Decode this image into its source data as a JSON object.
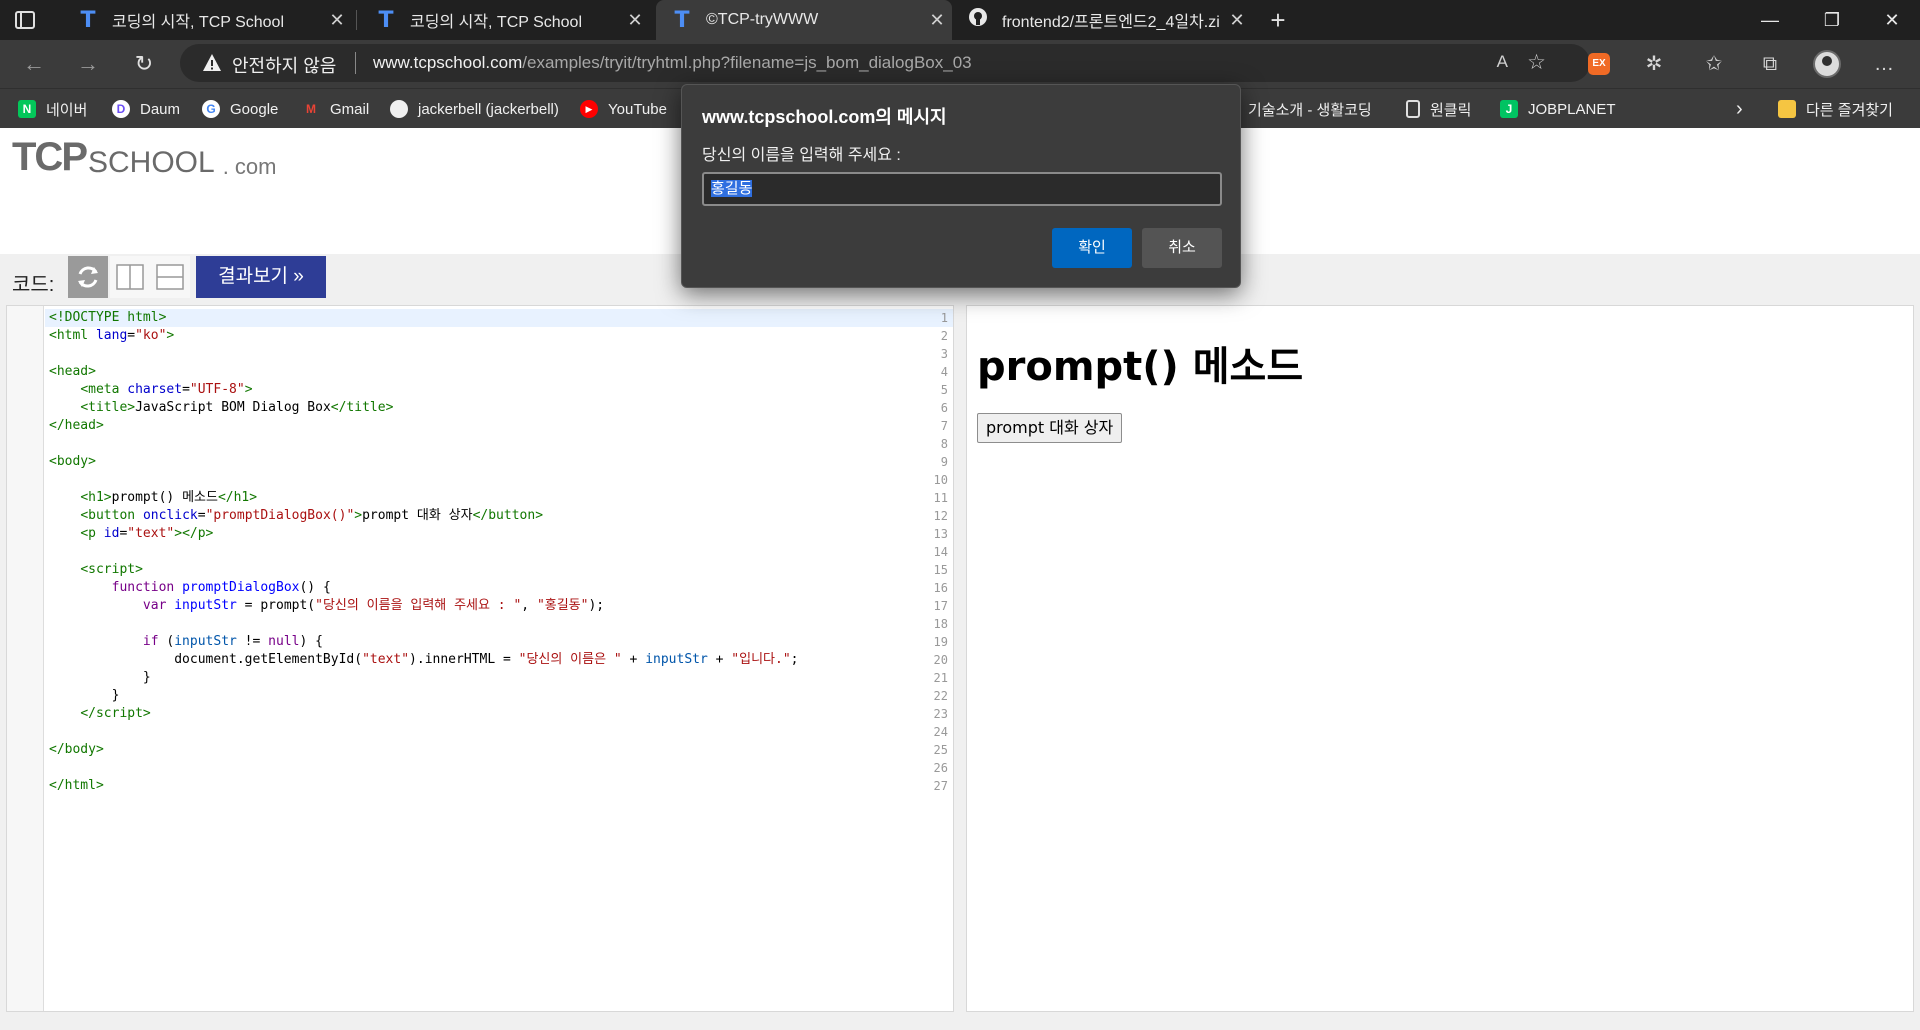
{
  "browser": {
    "tabs": [
      {
        "title": "코딩의 시작, TCP School",
        "favicon": "tcp-t-icon",
        "active": false
      },
      {
        "title": "코딩의 시작, TCP School",
        "favicon": "tcp-t-icon",
        "active": false
      },
      {
        "title": "©TCP-tryWWW",
        "favicon": "tcp-t-icon",
        "active": true
      },
      {
        "title": "frontend2/프론트엔드2_4일차.zi",
        "favicon": "github-icon",
        "active": false
      }
    ],
    "address": {
      "security_label": "안전하지 않음",
      "url_domain": "www.tcpschool.com",
      "url_path": "/examples/tryit/tryhtml.php?filename=js_bom_dialogBox_03",
      "read_aloud": "A",
      "ext_label": "EX"
    },
    "bookmarks": [
      {
        "label": "네이버",
        "icon": "naver-icon"
      },
      {
        "label": "Daum",
        "icon": "daum-icon"
      },
      {
        "label": "Google",
        "icon": "google-icon"
      },
      {
        "label": "Gmail",
        "icon": "gmail-icon"
      },
      {
        "label": "jackerbell (jackerbell)",
        "icon": "github-icon"
      },
      {
        "label": "YouTube",
        "icon": "youtube-icon"
      },
      {
        "label": "기술소개 - 생활코딩",
        "icon": "page-icon"
      },
      {
        "label": "원클릭",
        "icon": "page-icon"
      },
      {
        "label": "JOBPLANET",
        "icon": "jobplanet-icon"
      },
      {
        "label": "다른 즐겨찾기",
        "icon": "folder-icon"
      }
    ]
  },
  "site": {
    "logo_tcp": "TCP",
    "logo_school": "SCHOOL",
    "logo_dotcom": ". com",
    "code_label": "코드:",
    "result_button": "결과보기 »"
  },
  "editor": {
    "line_numbers": [
      "1",
      "2",
      "3",
      "4",
      "5",
      "6",
      "7",
      "8",
      "9",
      "10",
      "11",
      "12",
      "13",
      "14",
      "15",
      "16",
      "17",
      "18",
      "19",
      "20",
      "21",
      "22",
      "23",
      "24",
      "25",
      "26",
      "27"
    ]
  },
  "preview": {
    "heading": "prompt() 메소드",
    "button": "prompt 대화 상자"
  },
  "dialog": {
    "title": "www.tcpschool.com의 메시지",
    "message": "당신의 이름을 입력해 주세요 :",
    "input_value": "홍길동",
    "ok": "확인",
    "cancel": "취소"
  },
  "colors": {
    "accent": "#0067c0",
    "result_button_bg": "#2e3d96",
    "tag": "#117700",
    "attribute": "#0000cc",
    "string": "#aa1111",
    "keyword": "#770088"
  }
}
